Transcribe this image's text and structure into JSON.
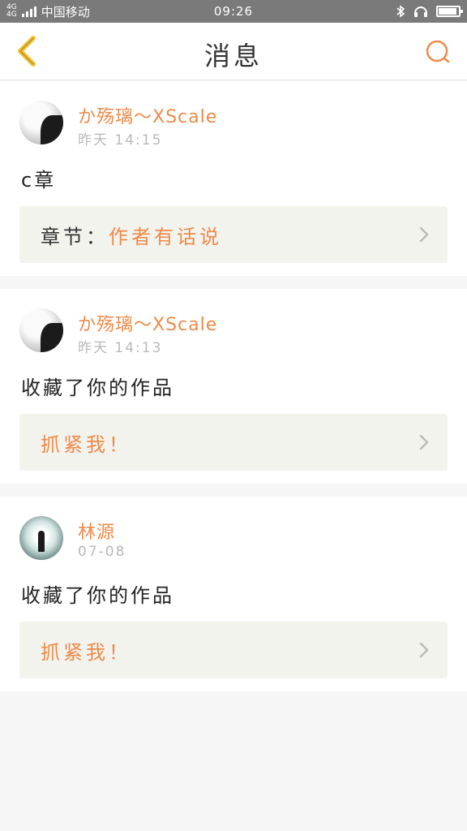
{
  "status_bar": {
    "network_top": "4G",
    "network_bottom": "4G",
    "carrier": "中国移动",
    "time": "09:26"
  },
  "header": {
    "title": "消息",
    "accent_color": "#ee8a4a",
    "back_icon_color": "#f2c230"
  },
  "messages": [
    {
      "user": "か殇璃〜XScale",
      "time": "昨天 14:15",
      "text": "c章",
      "link_label": "章节：",
      "link_value": "作者有话说",
      "avatar_icon": "avatar-grey-portrait-icon"
    },
    {
      "user": "か殇璃〜XScale",
      "time": "昨天 14:13",
      "text": "收藏了你的作品",
      "link_label": "",
      "link_value": "抓紧我！",
      "avatar_icon": "avatar-grey-portrait-icon"
    },
    {
      "user": "林源",
      "time": "07-08",
      "text": "收藏了你的作品",
      "link_label": "",
      "link_value": "抓紧我！",
      "avatar_icon": "avatar-tunnel-figure-icon"
    }
  ]
}
